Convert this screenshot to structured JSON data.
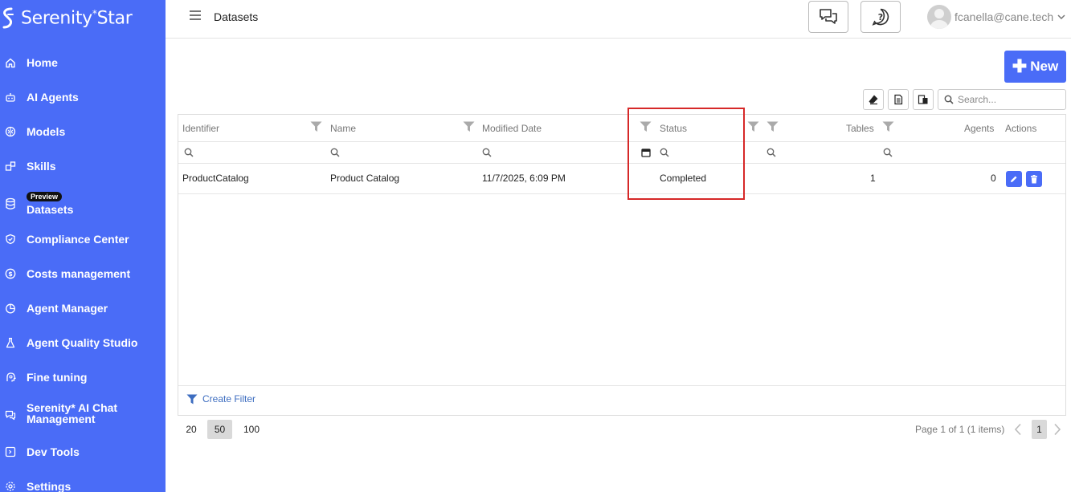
{
  "brand": {
    "name": "Serenity",
    "superscript": "*",
    "suffix": "Star"
  },
  "sidebar": {
    "items": [
      {
        "label": "Home",
        "icon": "home-icon"
      },
      {
        "label": "AI Agents",
        "icon": "robot-icon"
      },
      {
        "label": "Models",
        "icon": "brain-icon"
      },
      {
        "label": "Skills",
        "icon": "puzzle-icon"
      },
      {
        "label": "Datasets",
        "icon": "database-icon",
        "badge": "Preview",
        "active": true
      },
      {
        "label": "Compliance Center",
        "icon": "shield-icon"
      },
      {
        "label": "Costs management",
        "icon": "dollar-icon"
      },
      {
        "label": "Agent Manager",
        "icon": "pie-chart-icon"
      },
      {
        "label": "Agent Quality Studio",
        "icon": "flask-icon"
      },
      {
        "label": "Fine tuning",
        "icon": "brain-tuning-icon"
      },
      {
        "label": "Serenity* AI Chat Management",
        "icon": "chat-icon"
      },
      {
        "label": "Dev Tools",
        "icon": "code-icon"
      },
      {
        "label": "Settings",
        "icon": "gear-icon"
      }
    ]
  },
  "header": {
    "title": "Datasets",
    "user_email": "fcanella@cane.tech"
  },
  "toolbar": {
    "new_label": "New",
    "search_placeholder": "Search..."
  },
  "grid": {
    "columns": [
      "Identifier",
      "Name",
      "Modified Date",
      "Status",
      "Tables",
      "Agents",
      "Actions"
    ],
    "rows": [
      {
        "identifier": "ProductCatalog",
        "name": "Product Catalog",
        "modified": "11/7/2025, 6:09 PM",
        "status": "Completed",
        "tables": "1",
        "agents": "0"
      }
    ],
    "create_filter_label": "Create Filter"
  },
  "pager": {
    "sizes": [
      "20",
      "50",
      "100"
    ],
    "selected_size": "50",
    "info": "Page 1 of 1 (1 items)",
    "current_page": "1"
  },
  "colors": {
    "accent": "#4a6cf7",
    "highlight": "#d62828"
  }
}
